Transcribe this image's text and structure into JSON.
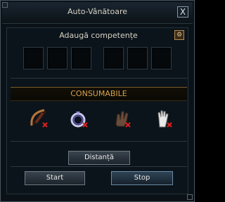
{
  "window": {
    "title": "Auto-Vânătoare",
    "close_glyph": "X"
  },
  "skills": {
    "header": "Adaugă competențe",
    "slot_count": 6
  },
  "consumables": {
    "header": "CONSUMABILE",
    "items": [
      {
        "icon": "bow-and-arrow-icon"
      },
      {
        "icon": "ring-icon"
      },
      {
        "icon": "hand-glove-icon"
      },
      {
        "icon": "white-glove-icon"
      }
    ]
  },
  "buttons": {
    "distance": "Distanță",
    "start": "Start",
    "stop": "Stop"
  },
  "colors": {
    "accent": "#d9a24a",
    "panel_bg": "#0b141a",
    "remove_marker": "#e02020"
  }
}
